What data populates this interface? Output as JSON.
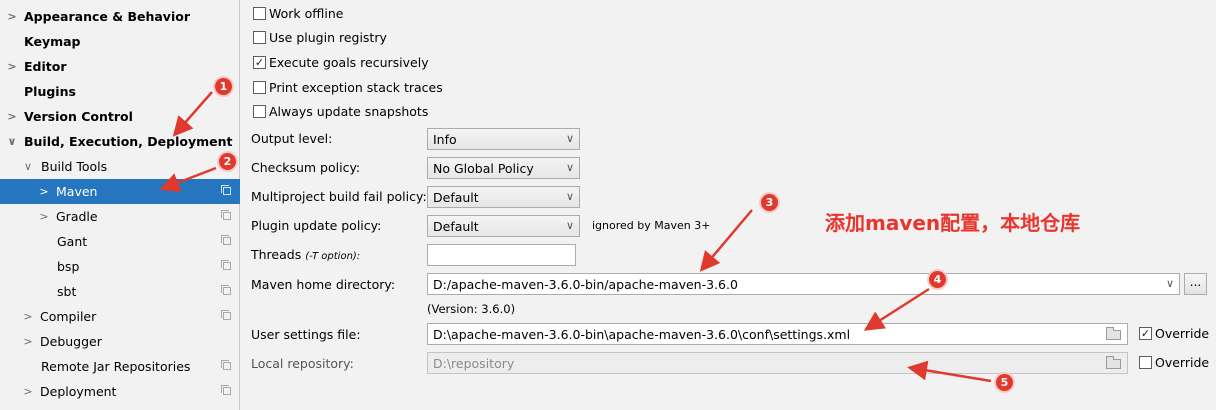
{
  "sidebar": {
    "items": [
      {
        "label": "Appearance & Behavior",
        "expandable": true,
        "bold": true
      },
      {
        "label": "Keymap",
        "expandable": false,
        "bold": true
      },
      {
        "label": "Editor",
        "expandable": true,
        "bold": true
      },
      {
        "label": "Plugins",
        "expandable": false,
        "bold": true
      },
      {
        "label": "Version Control",
        "expandable": true,
        "bold": true
      },
      {
        "label": "Build, Execution, Deployment",
        "expandable": true,
        "bold": true,
        "expanded": true
      },
      {
        "label": "Build Tools",
        "expandable": true,
        "expanded": true
      },
      {
        "label": "Maven",
        "expandable": true,
        "selected": true
      },
      {
        "label": "Gradle",
        "expandable": true
      },
      {
        "label": "Gant"
      },
      {
        "label": "bsp"
      },
      {
        "label": "sbt"
      },
      {
        "label": "Compiler",
        "expandable": true
      },
      {
        "label": "Debugger",
        "expandable": true
      },
      {
        "label": "Remote Jar Repositories"
      },
      {
        "label": "Deployment",
        "expandable": true
      }
    ]
  },
  "options": {
    "work_offline": {
      "label": "Work offline",
      "checked": false
    },
    "use_plugin_registry": {
      "label": "Use plugin registry",
      "checked": false
    },
    "execute_goals_recursively": {
      "label": "Execute goals recursively",
      "checked": true
    },
    "print_exception_stack_traces": {
      "label": "Print exception stack traces",
      "checked": false
    },
    "always_update_snapshots": {
      "label": "Always update snapshots",
      "checked": false
    }
  },
  "settings": {
    "output_level": {
      "label": "Output level:",
      "value": "Info"
    },
    "checksum_policy": {
      "label": "Checksum policy:",
      "value": "No Global Policy"
    },
    "multiproject_fail_policy": {
      "label": "Multiproject build fail policy:",
      "value": "Default"
    },
    "plugin_update_policy": {
      "label": "Plugin update policy:",
      "value": "Default",
      "note": "ignored by Maven 3+"
    },
    "threads": {
      "label": "Threads",
      "hint": "(-T option):",
      "value": ""
    },
    "maven_home": {
      "label": "Maven home directory:",
      "value": "D:/apache-maven-3.6.0-bin/apache-maven-3.6.0",
      "version": "(Version: 3.6.0)",
      "browse_label": "..."
    },
    "user_settings": {
      "label": "User settings file:",
      "value": "D:\\apache-maven-3.6.0-bin\\apache-maven-3.6.0\\conf\\settings.xml",
      "override_label": "Override",
      "override_checked": true
    },
    "local_repository": {
      "label": "Local repository:",
      "value": "D:\\repository",
      "override_label": "Override",
      "override_checked": false
    }
  },
  "annotations": {
    "text": "添加maven配置，本地仓库",
    "markers": [
      "1",
      "2",
      "3",
      "4",
      "5"
    ],
    "color": "#e8362f"
  }
}
